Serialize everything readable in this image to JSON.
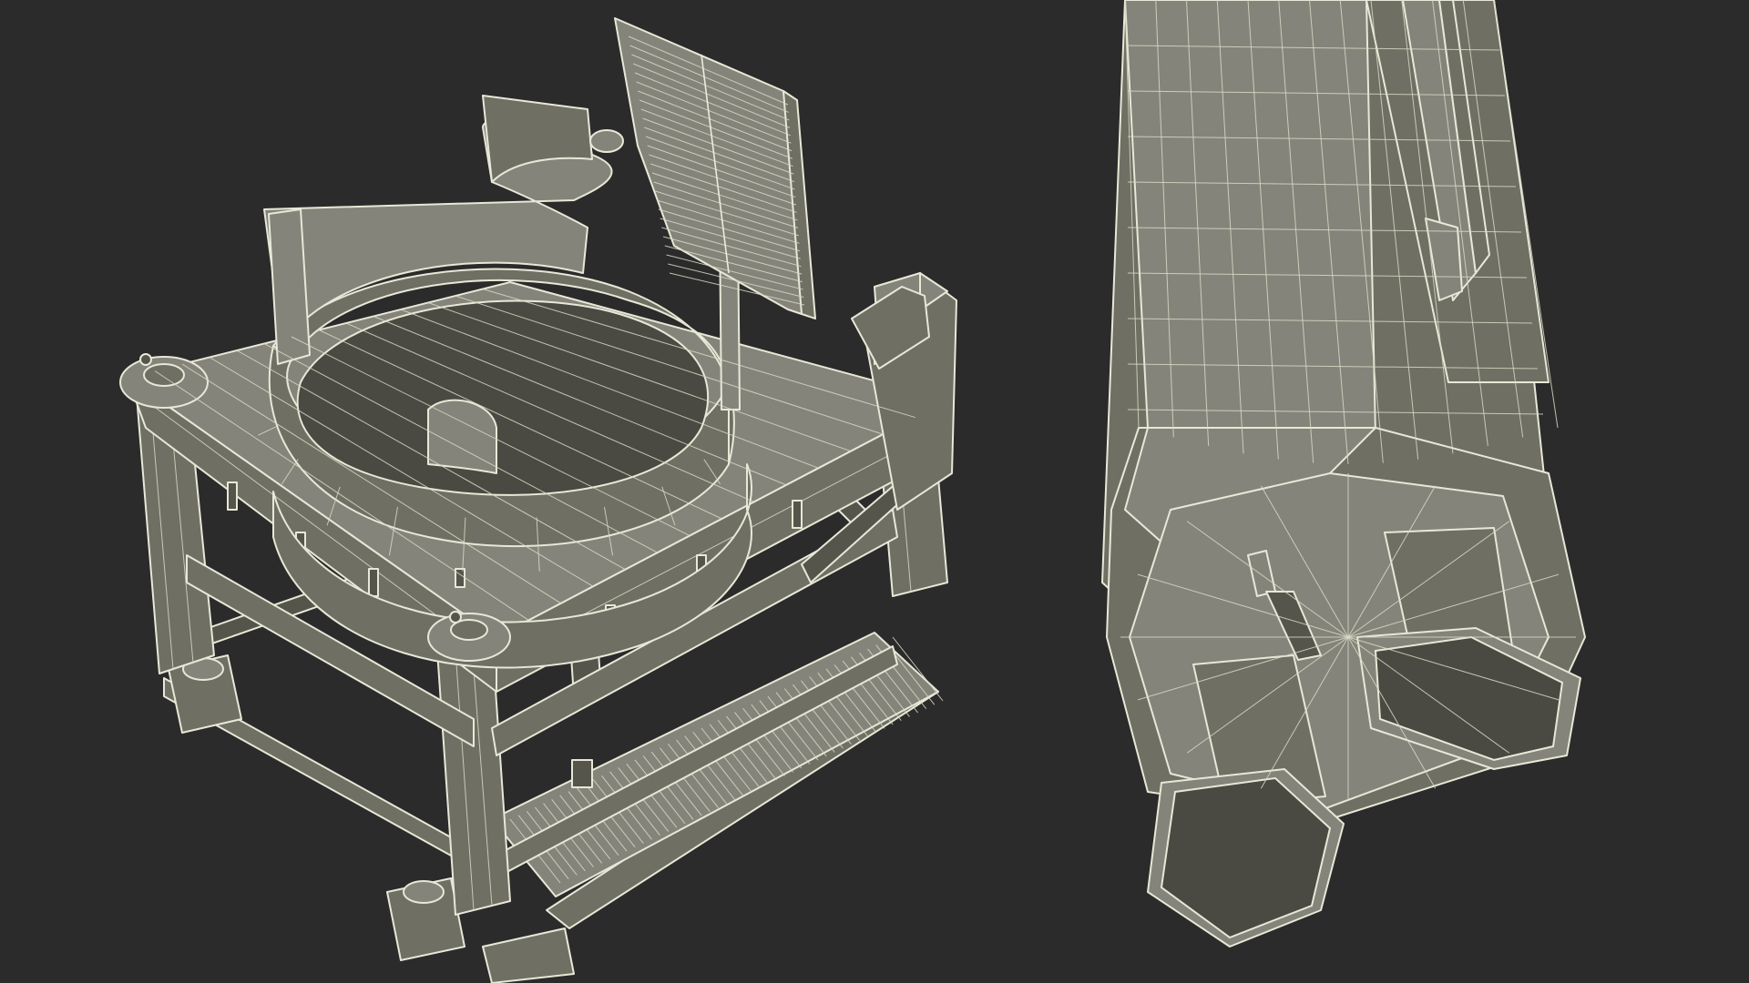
{
  "scene": {
    "background_color": "#2b2b2b",
    "surface_color": "#6f6f63",
    "wire_color": "#e8e8d8",
    "objects": [
      {
        "id": "launch-stand",
        "icon": "wireframe-stand-render"
      },
      {
        "id": "rocket-booster",
        "icon": "wireframe-booster-render"
      }
    ]
  }
}
